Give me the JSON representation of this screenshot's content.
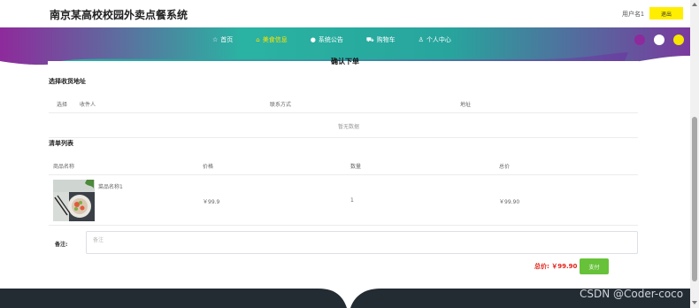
{
  "header": {
    "site_title": "南京某高校校园外卖点餐系统",
    "username": "用户名1",
    "logout_label": "退出"
  },
  "nav": {
    "items": [
      {
        "label": "首页",
        "icon": "star-icon",
        "glyph": "☆",
        "active": false
      },
      {
        "label": "美食信息",
        "icon": "bell-icon",
        "glyph": "⌂",
        "active": true
      },
      {
        "label": "系统公告",
        "icon": "circle-icon",
        "glyph": "●",
        "active": false
      },
      {
        "label": "购物车",
        "icon": "cart-icon",
        "glyph": "⛟",
        "active": false
      },
      {
        "label": "个人中心",
        "icon": "user-icon",
        "glyph": "♙",
        "active": false
      }
    ],
    "theme_dots": [
      "#8e2a9c",
      "#ffffff",
      "#f6e500"
    ],
    "accent": "#ffe600",
    "gradient": [
      "#8e2a9c",
      "#2ab3a2"
    ]
  },
  "page": {
    "heading": "确认下单"
  },
  "address": {
    "title": "选择收货地址",
    "columns": [
      "选择",
      "收件人",
      "联系方式",
      "地址"
    ],
    "empty_text": "暂无数据"
  },
  "order": {
    "title": "清单列表",
    "columns": [
      "商品名称",
      "价格",
      "数量",
      "总价"
    ],
    "rows": [
      {
        "name": "菜品名称1",
        "price": "￥99.9",
        "qty": "1",
        "total": "￥99.90"
      }
    ]
  },
  "remark": {
    "label": "备注:",
    "placeholder": "备注",
    "value": ""
  },
  "summary": {
    "total_text": "总价: ￥99.90",
    "pay_label": "支付",
    "total_color": "#e2231a",
    "pay_color": "#67c23a"
  },
  "watermark": "CSDN @Coder-coco"
}
